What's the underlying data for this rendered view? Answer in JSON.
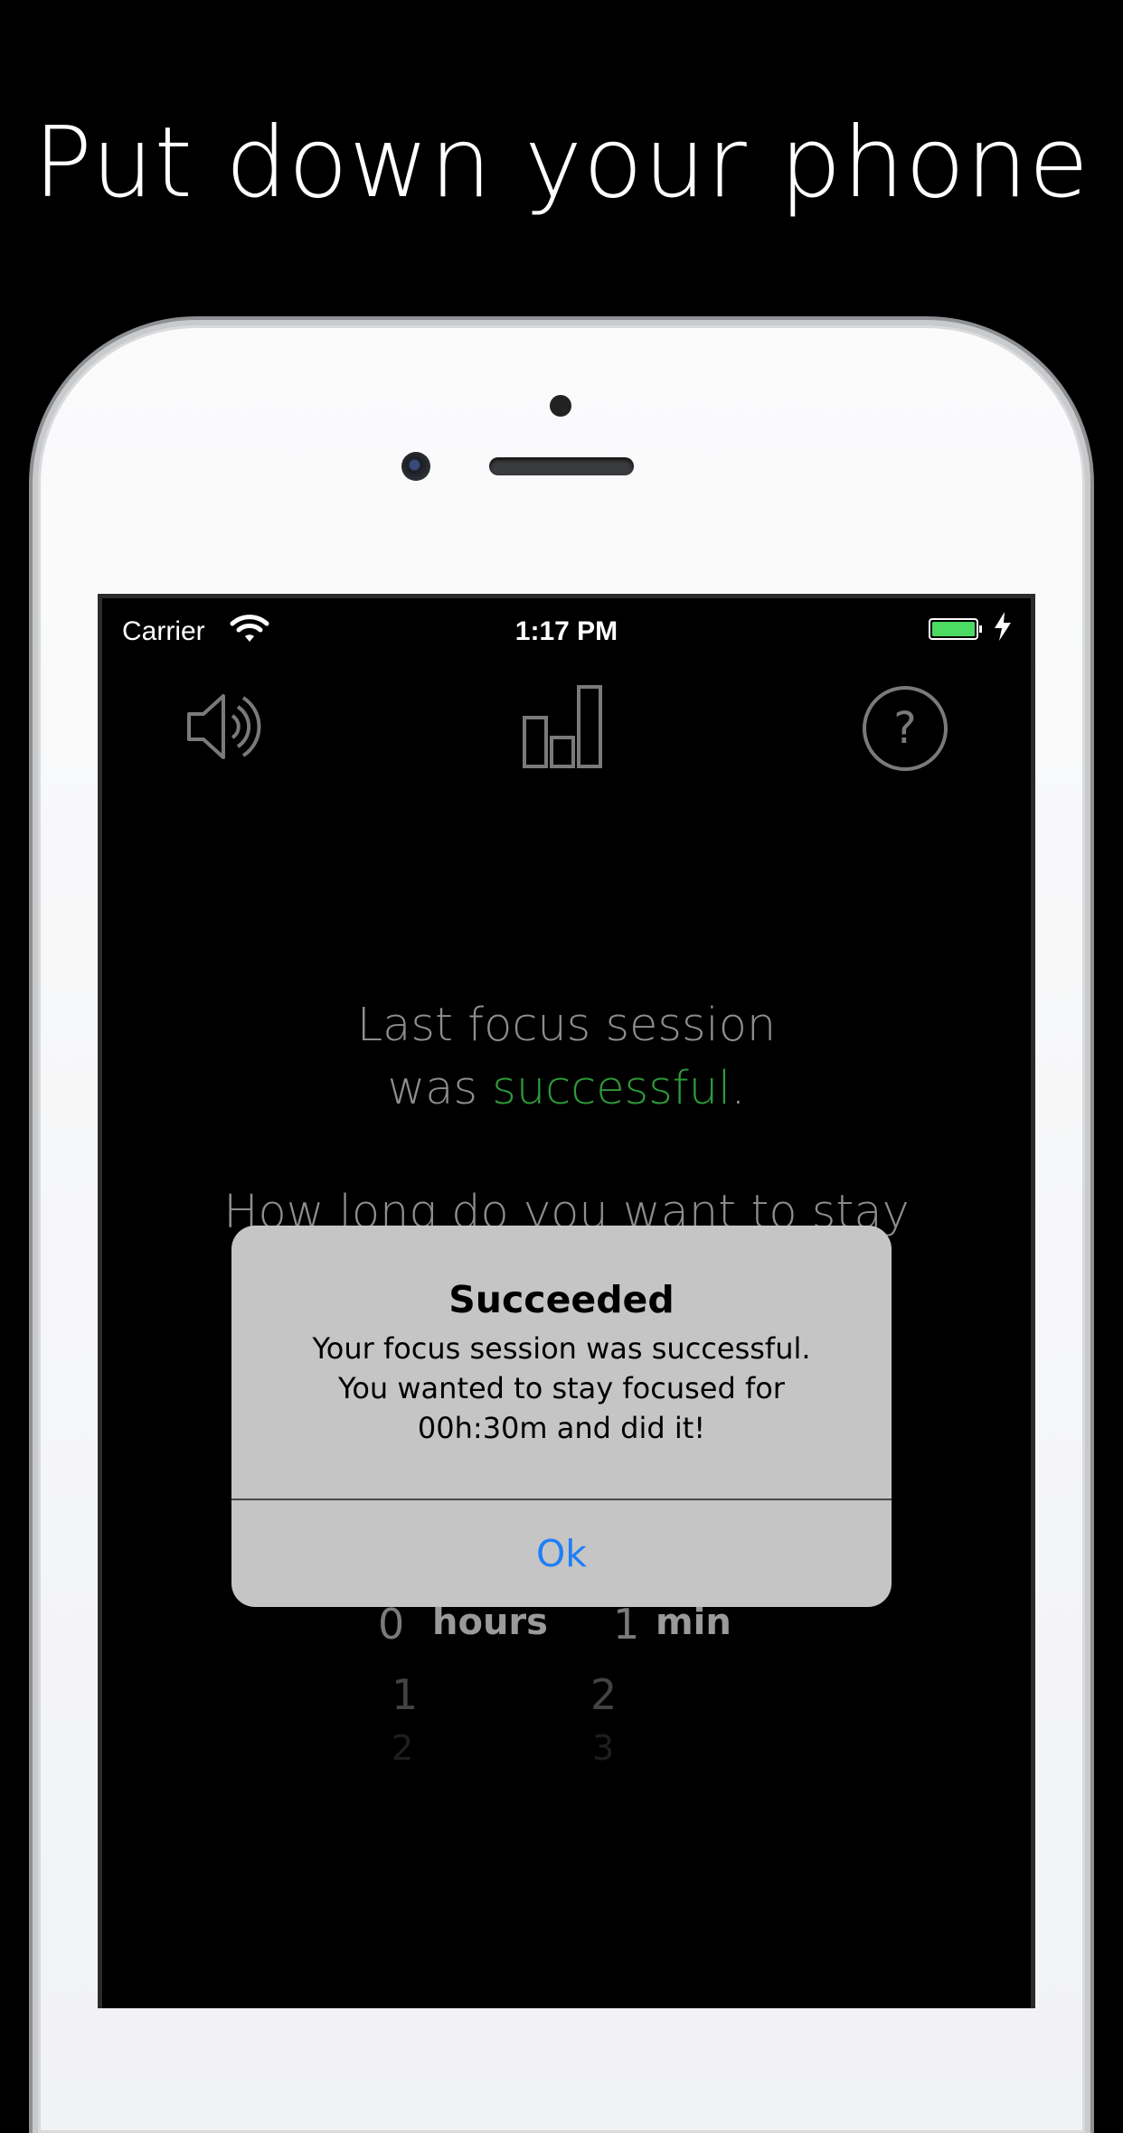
{
  "headline": "Put down your phone",
  "status_bar": {
    "carrier": "Carrier",
    "time": "1:17 PM",
    "battery_color": "#4cd964"
  },
  "toolbar": {
    "sound_icon": "speaker-icon",
    "stats_icon": "bar-chart-icon",
    "help_icon": "question-circle-icon"
  },
  "main": {
    "last_session_line1": "Last focus session",
    "last_session_was": "was ",
    "last_session_status": "successful",
    "last_session_end": ".",
    "question_text": "How long do you want to stay",
    "success_color": "#2e9a39"
  },
  "picker": {
    "hours_label": "hours",
    "min_label": "min",
    "hours_values": [
      "0",
      "1",
      "2"
    ],
    "min_values": [
      "1",
      "2",
      "3"
    ]
  },
  "alert": {
    "title": "Succeeded",
    "line1": "Your focus session was successful.",
    "line2": "You wanted to stay focused for",
    "line3": "00h:30m and did it!",
    "ok_label": "Ok",
    "ok_color": "#1e7ef7"
  }
}
